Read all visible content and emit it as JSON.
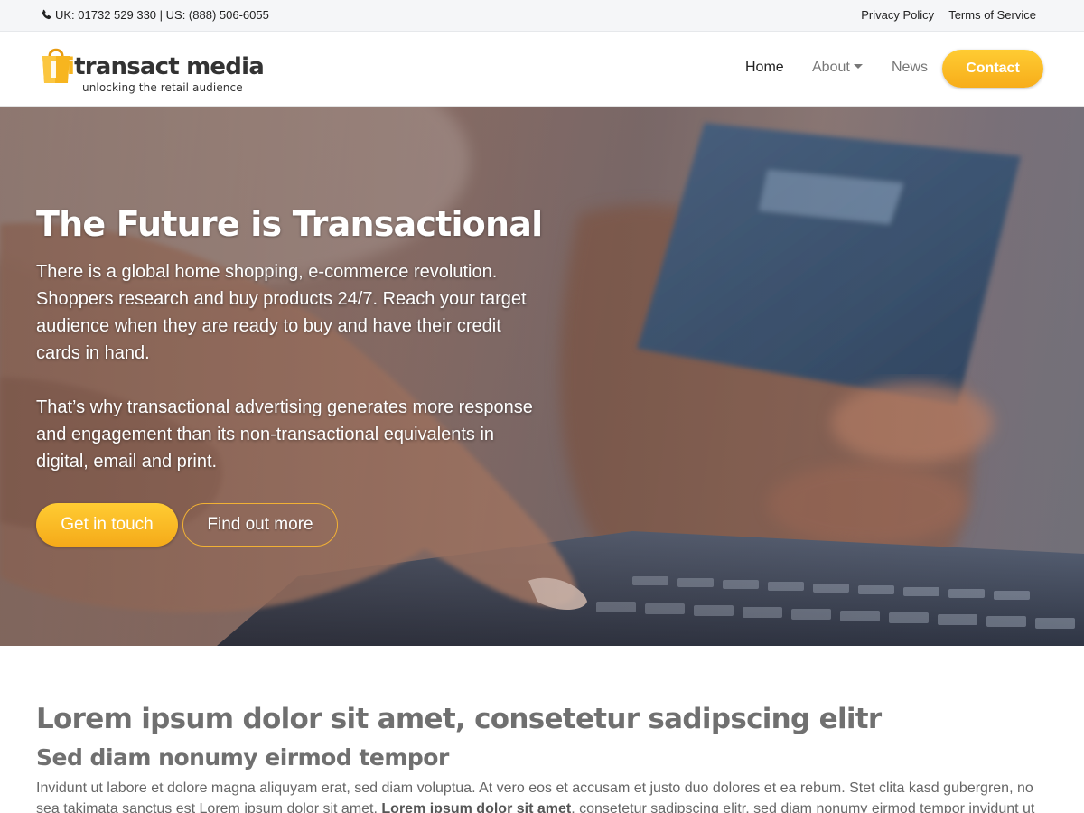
{
  "topbar": {
    "phone_icon": "phone-icon",
    "phone_text": "UK: 01732 529 330 | US: (888) 506-6055",
    "privacy_label": "Privacy Policy",
    "terms_label": "Terms of Service"
  },
  "brand": {
    "wordmark_i": "i",
    "wordmark_rest": "transact media",
    "tagline": "unlocking the retail audience",
    "logo_icon": "shopping-bag-icon",
    "accent_color": "#f7b51f"
  },
  "nav": {
    "home_label": "Home",
    "about_label": "About",
    "news_label": "News",
    "contact_label": "Contact"
  },
  "hero": {
    "title": "The Future is Transactional",
    "paragraph_1": "There is a global home shopping, e-commerce revolution. Shoppers research and buy products 24/7. Reach your target audience when they are ready to buy and have their credit cards in hand.",
    "paragraph_2": "That’s why transactional advertising generates more response and engagement than its non-transactional equivalents in digital, email and print.",
    "primary_button": "Get in touch",
    "secondary_button": "Find out more"
  },
  "content": {
    "title": "Lorem ipsum dolor sit amet, consetetur sadipscing elitr",
    "subtitle": "Sed diam nonumy eirmod tempor",
    "body_start": "Invidunt ut labore et dolore magna aliquyam erat, sed diam voluptua. At vero eos et accusam et justo duo dolores et ea rebum. Stet clita kasd gubergren, no sea takimata sanctus est Lorem ipsum dolor sit amet. ",
    "body_bold": "Lorem ipsum dolor sit amet",
    "body_end": ", consetetur sadipscing elitr, sed diam nonumy eirmod tempor invidunt ut"
  }
}
